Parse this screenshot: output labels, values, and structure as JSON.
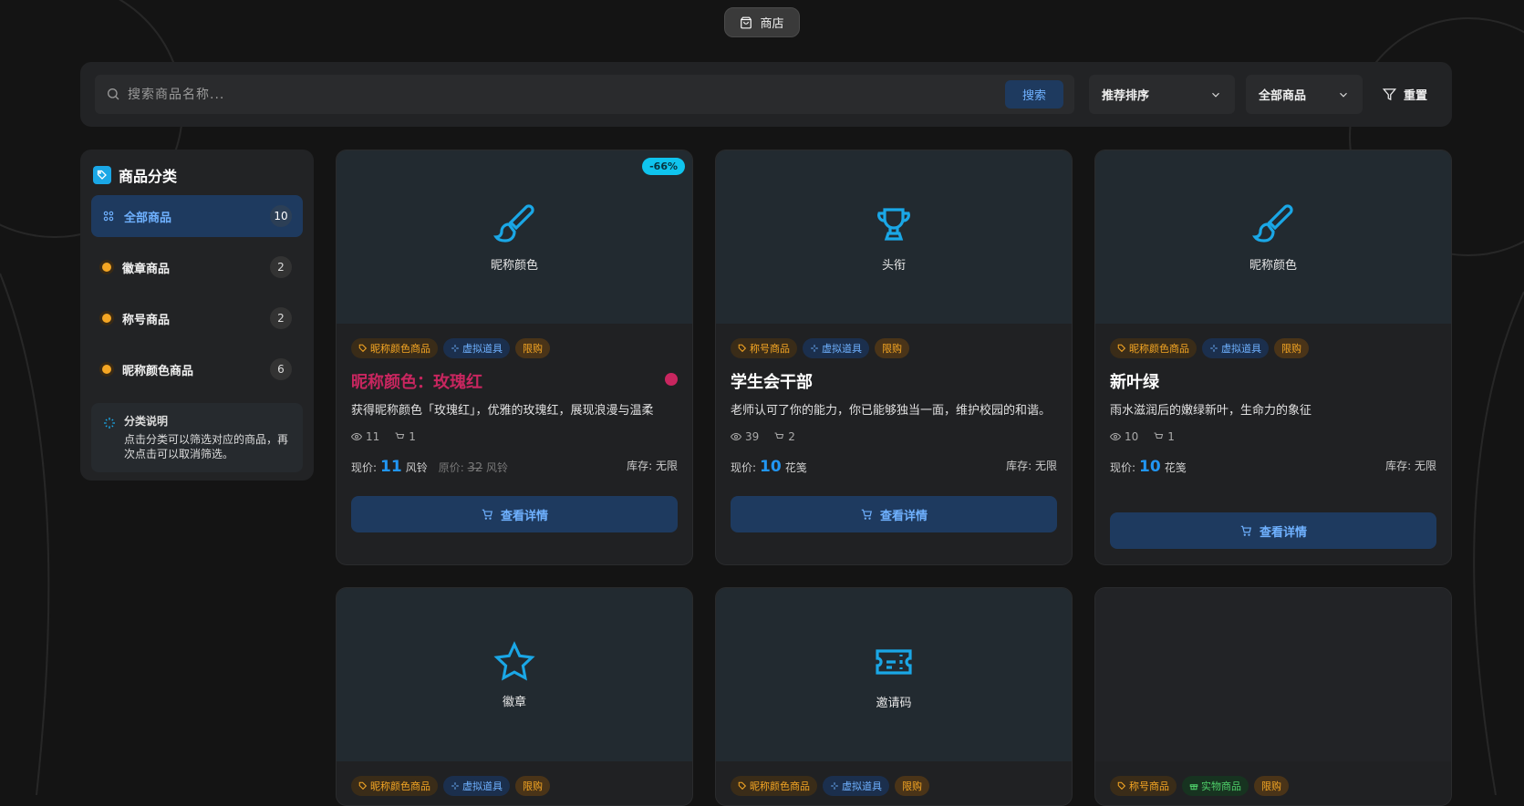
{
  "nav": {
    "shop_label": "商店"
  },
  "filters": {
    "search_placeholder": "搜索商品名称...",
    "search_button": "搜索",
    "sort_label": "推荐排序",
    "type_label": "全部商品",
    "reset_label": "重置"
  },
  "sidebar": {
    "title": "商品分类",
    "items": [
      {
        "label": "全部商品",
        "count": "10"
      },
      {
        "label": "徽章商品",
        "count": "2"
      },
      {
        "label": "称号商品",
        "count": "2"
      },
      {
        "label": "昵称颜色商品",
        "count": "6"
      }
    ],
    "note_title": "分类说明",
    "note_text": "点击分类可以筛选对应的商品，再次点击可以取消筛选。"
  },
  "labels": {
    "current_price": "现价:",
    "original_price": "原价:",
    "stock": "库存: 无限",
    "view_detail": "查看详情",
    "limit": "限购",
    "virtual": "虚拟道具",
    "physical": "实物商品"
  },
  "cards": [
    {
      "caption": "昵称颜色",
      "discount": "-66%",
      "cat": "昵称颜色商品",
      "title": "昵称颜色：玫瑰红",
      "desc": "获得昵称颜色「玫瑰红」，优雅的玫瑰红，展现浪漫与温柔",
      "views": "11",
      "buys": "1",
      "price": "11",
      "currency": "风铃",
      "orig_price": "32",
      "orig_currency": "风铃"
    },
    {
      "caption": "头衔",
      "cat": "称号商品",
      "title": "学生会干部",
      "desc": "老师认可了你的能力，你已能够独当一面，维护校园的和谐。",
      "views": "39",
      "buys": "2",
      "price": "10",
      "currency": "花笺"
    },
    {
      "caption": "昵称颜色",
      "cat": "昵称颜色商品",
      "title": "新叶绿",
      "desc": "雨水滋润后的嫩绿新叶，生命力的象征",
      "views": "10",
      "buys": "1",
      "price": "10",
      "currency": "花笺"
    },
    {
      "caption": "徽章",
      "cat": "昵称颜色商品"
    },
    {
      "caption": "邀请码",
      "cat": "昵称颜色商品"
    },
    {
      "caption": "",
      "cat": "称号商品"
    }
  ],
  "colors": {
    "accent": "#2196f3",
    "rose": "#c8265f",
    "badge": "#0fc4ee",
    "orange": "#f5a623"
  }
}
